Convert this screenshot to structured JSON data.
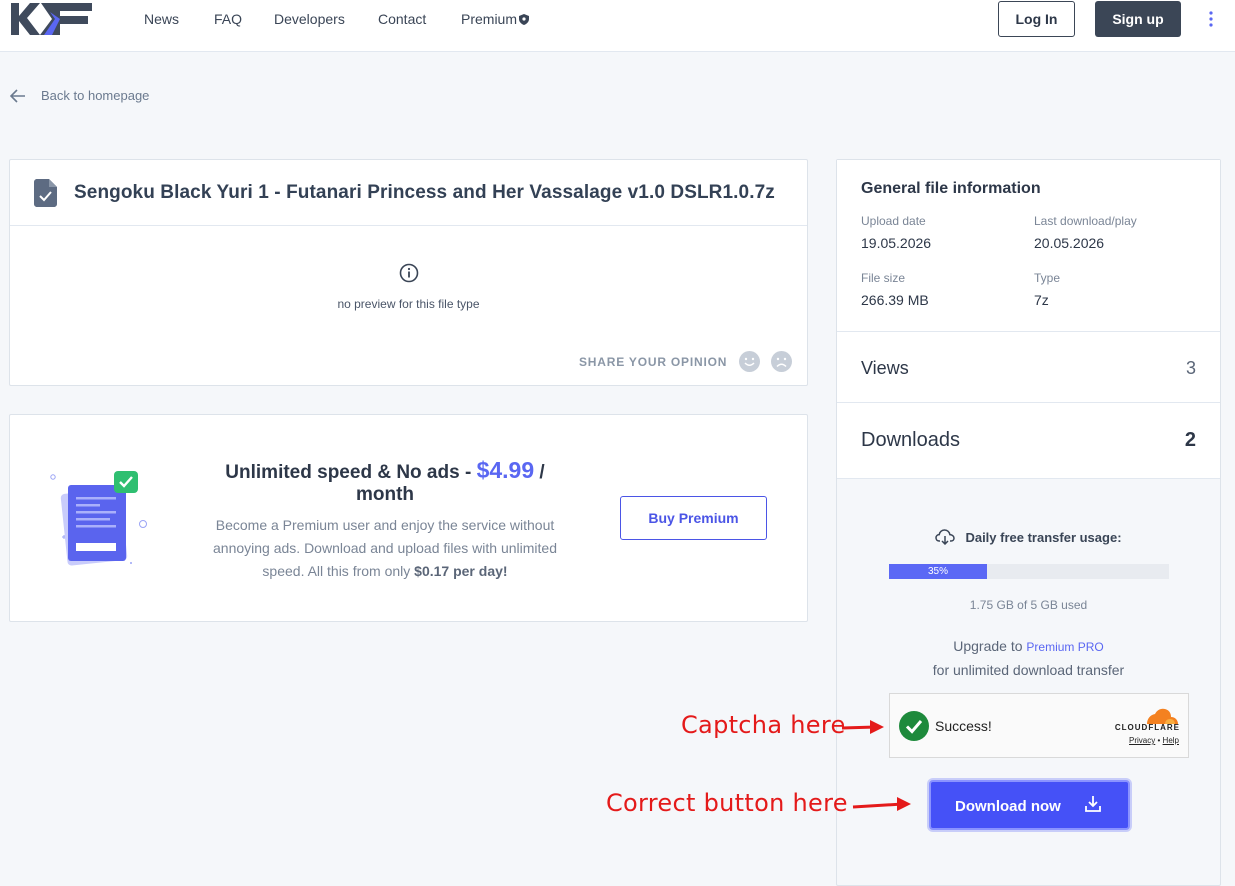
{
  "header": {
    "logo_alt": "KF",
    "nav": {
      "news": "News",
      "faq": "FAQ",
      "developers": "Developers",
      "contact": "Contact",
      "premium": "Premium"
    },
    "login": "Log In",
    "signup": "Sign up"
  },
  "back_link": "Back to homepage",
  "file": {
    "title": "Sengoku Black Yuri 1 - Futanari Princess and Her Vassalage v1.0 DSLR1.0.7z",
    "preview_text": "no preview for this file type",
    "opinion_label": "SHARE YOUR OPINION"
  },
  "promo": {
    "title_prefix": "Unlimited speed & No ads - ",
    "price": "$4.99",
    "title_suffix": " / month",
    "desc_text": "Become a Premium user and enjoy the service without annoying ads. Download and upload files with unlimited speed. All this from only ",
    "desc_bold": "$0.17 per day!",
    "button": "Buy Premium"
  },
  "info": {
    "title": "General file information",
    "upload_date_label": "Upload date",
    "upload_date": "19.05.2026",
    "last_download_label": "Last download/play",
    "last_download": "20.05.2026",
    "file_size_label": "File size",
    "file_size": "266.39 MB",
    "type_label": "Type",
    "type": "7z",
    "views_label": "Views",
    "views": "3",
    "downloads_label": "Downloads",
    "downloads": "2"
  },
  "transfer": {
    "label": "Daily free transfer usage:",
    "progress_percent": 35,
    "progress_text": "35%",
    "used_text": "1.75 GB of 5 GB used",
    "upgrade_prefix": "Upgrade to",
    "upgrade_link": "Premium PRO",
    "upgrade_suffix": "for unlimited download transfer"
  },
  "captcha": {
    "status": "Success!",
    "brand": "CLOUDFLARE",
    "privacy": "Privacy",
    "separator": "•",
    "help": "Help"
  },
  "download_button": "Download now",
  "annotations": {
    "captcha": "Captcha here",
    "button": "Correct button here"
  },
  "colors": {
    "accent": "#4551f7",
    "annotation": "#e41a1a",
    "success": "#1e8a3c",
    "header_dark": "#3b4656"
  }
}
